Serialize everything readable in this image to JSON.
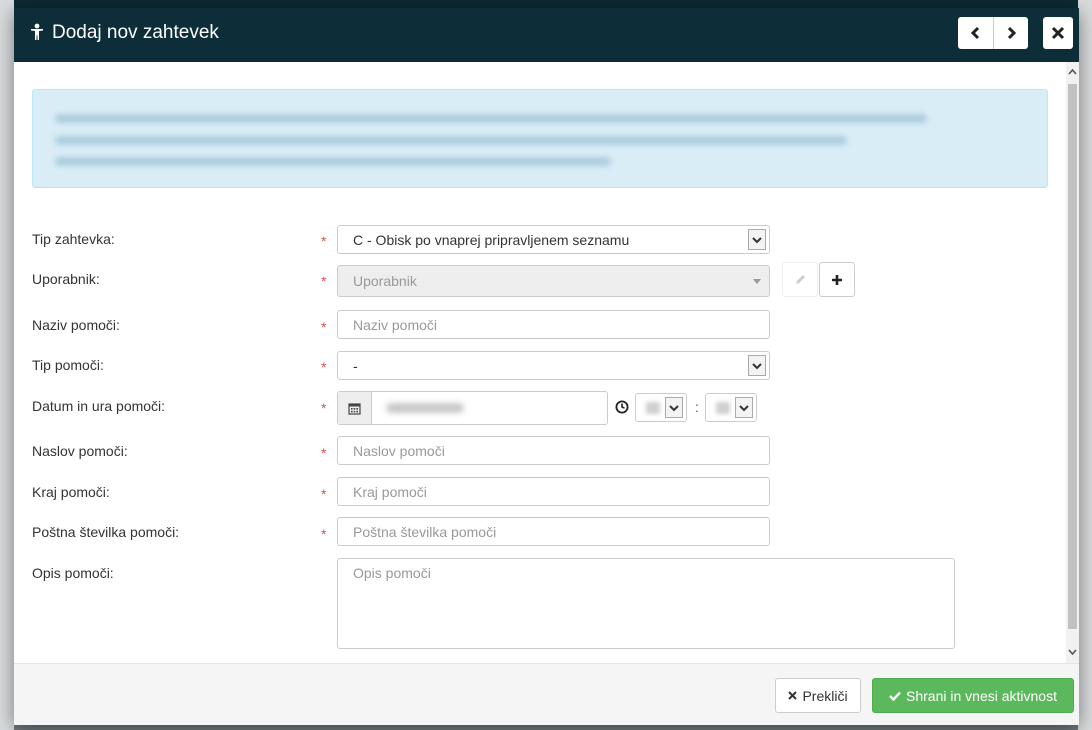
{
  "modal": {
    "title": "Dodaj nov zahtevek",
    "icons": {
      "title": "figure-icon",
      "prev": "chevron-left-icon",
      "next": "chevron-right-icon",
      "close": "close-icon"
    }
  },
  "form": {
    "request_type": {
      "label": "Tip zahtevka:",
      "value": "C - Obisk po vnaprej pripravljenem seznamu"
    },
    "user": {
      "label": "Uporabnik:",
      "placeholder": "Uporabnik",
      "edit_icon": "pencil-icon",
      "add_icon": "plus-icon"
    },
    "help_name": {
      "label": "Naziv pomoči:",
      "placeholder": "Naziv pomoči"
    },
    "help_type": {
      "label": "Tip pomoči:",
      "value": "-"
    },
    "help_datetime": {
      "label": "Datum in ura pomoči:",
      "calendar_icon": "calendar-icon",
      "clock_icon": "clock-icon",
      "time_separator": ":"
    },
    "help_address": {
      "label": "Naslov pomoči:",
      "placeholder": "Naslov pomoči"
    },
    "help_city": {
      "label": "Kraj pomoči:",
      "placeholder": "Kraj pomoči"
    },
    "help_postal": {
      "label": "Poštna številka pomoči:",
      "placeholder": "Poštna številka pomoči"
    },
    "help_description": {
      "label": "Opis pomoči:",
      "placeholder": "Opis pomoči"
    },
    "required_marker": "*"
  },
  "footer": {
    "cancel_label": "Prekliči",
    "save_label": "Shrani in vnesi aktivnost"
  },
  "colors": {
    "header_bg": "#0d2d39",
    "info_bg": "#d9edf7",
    "required": "#d9534f",
    "success": "#5cb85c"
  }
}
